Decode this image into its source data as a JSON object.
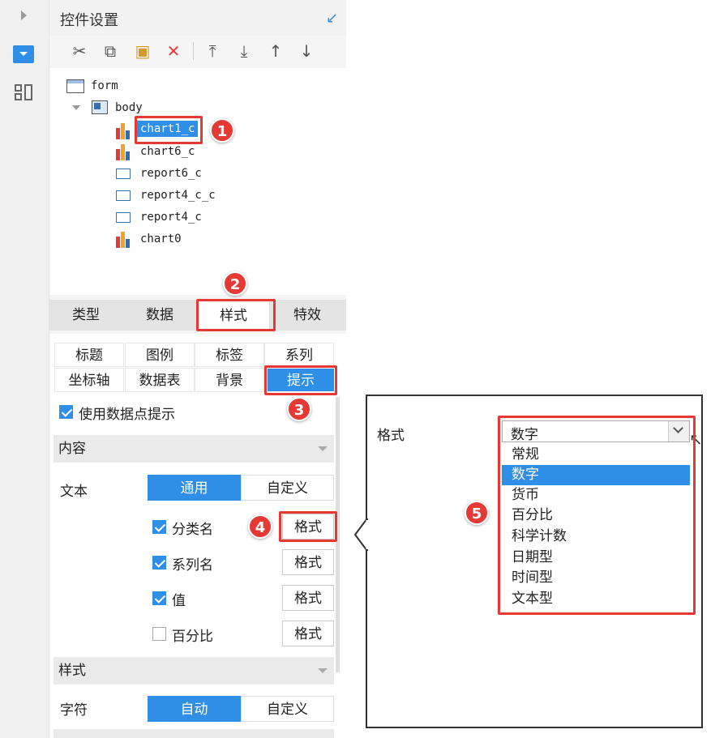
{
  "panel": {
    "title": "控件设置"
  },
  "tree": {
    "root": "form",
    "body": "body",
    "items": [
      "chart1_c",
      "chart6_c",
      "report6_c",
      "report4_c_c",
      "report4_c",
      "chart0"
    ]
  },
  "tabs": [
    "类型",
    "数据",
    "样式",
    "特效"
  ],
  "subtabs": [
    "标题",
    "图例",
    "标签",
    "系列",
    "坐标轴",
    "数据表",
    "背景",
    "提示"
  ],
  "tooltip_checkbox": "使用数据点提示",
  "content_section": {
    "title": "内容",
    "text_label": "文本",
    "segments": [
      "通用",
      "自定义"
    ],
    "rows": [
      {
        "label": "分类名",
        "checked": true,
        "button": "格式"
      },
      {
        "label": "系列名",
        "checked": true,
        "button": "格式"
      },
      {
        "label": "值",
        "checked": true,
        "button": "格式"
      },
      {
        "label": "百分比",
        "checked": false,
        "button": "格式"
      }
    ]
  },
  "style_section": {
    "title": "样式",
    "char_label": "字符",
    "segments": [
      "自动",
      "自定义"
    ]
  },
  "popup": {
    "format_label": "格式",
    "selected": "数字",
    "options": [
      "常规",
      "数字",
      "货币",
      "百分比",
      "科学计数",
      "日期型",
      "时间型",
      "文本型"
    ]
  },
  "badges": [
    "1",
    "2",
    "3",
    "4",
    "5"
  ],
  "colors": {
    "accent": "#2f8ee5",
    "highlight": "#e53935"
  }
}
